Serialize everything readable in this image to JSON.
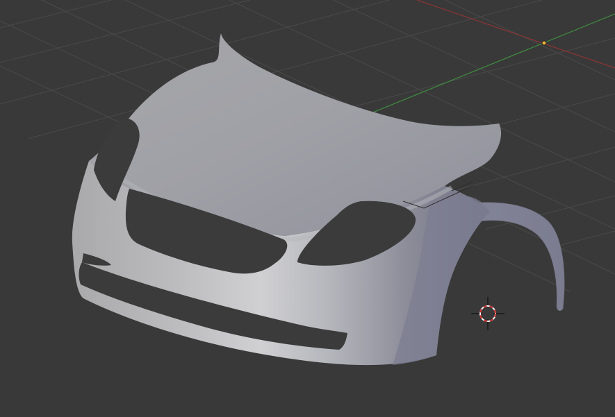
{
  "viewport": {
    "kind": "3d-viewport",
    "shading": "solid",
    "background_color": "#393939",
    "grid_color": "#4a4a4a",
    "x_axis_color": "#8f3434",
    "y_axis_color": "#3f8f3f"
  },
  "scene": {
    "object": {
      "kind": "mesh",
      "shape": "car-front-body-panel",
      "base_color": "#a2a3a8"
    },
    "origin_point_color": "#f2b33b",
    "cursor": {
      "icon": "3d-cursor-icon",
      "ring_colors": [
        "#d12f2f",
        "#ffffff"
      ]
    }
  }
}
